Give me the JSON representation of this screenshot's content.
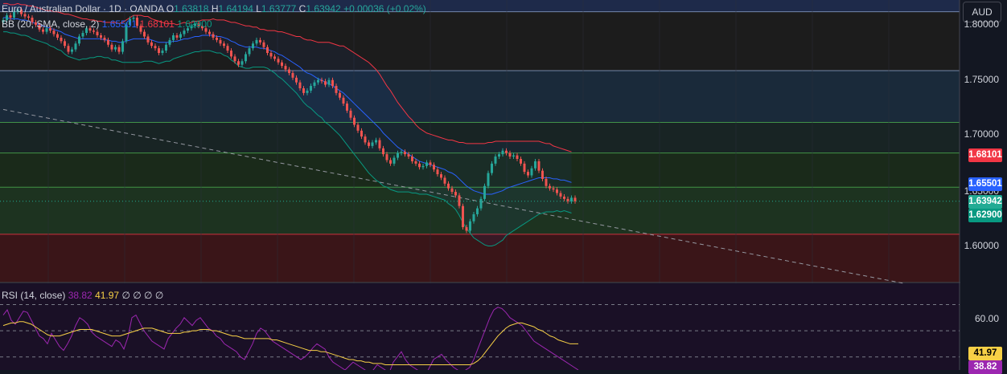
{
  "header": {
    "symbol": "Euro / Australian Dollar · 1D · OANDA",
    "open_label": "O",
    "open": "1.63818",
    "high_label": "H",
    "high": "1.64194",
    "low_label": "L",
    "low": "1.63777",
    "close_label": "C",
    "close": "1.63942",
    "change": "+0.00036 (+0.02%)"
  },
  "bb_legend": {
    "label": "BB (20, SMA, close, 2)",
    "basis": "1.65501",
    "upper": "1.68101",
    "lower": "1.62900"
  },
  "rsi_legend": {
    "label": "RSI (14, close)",
    "rsi": "38.82",
    "ma": "41.97",
    "extras": "∅ ∅ ∅ ∅"
  },
  "currency_button": "AUD",
  "price_axis": {
    "ticks": [
      "1.80000",
      "1.75000",
      "1.70000",
      "1.65000",
      "1.60000"
    ],
    "tags": {
      "upper": "1.68101",
      "basis": "1.65501",
      "close": "1.63942",
      "lower": "1.62900"
    }
  },
  "rsi_axis": {
    "ticks": [
      "60.00"
    ],
    "tags": {
      "ma": "41.97",
      "rsi": "38.82"
    }
  },
  "colors": {
    "up": "#26a69a",
    "down": "#ef5350",
    "basis": "#2962ff",
    "upper": "#f23645",
    "lower": "#089981",
    "rsi": "#9c27b0",
    "rsi_ma": "#f7d046",
    "close_tag": "#22ab94"
  },
  "chart_data": {
    "type": "candlestick",
    "instrument": "Euro / Australian Dollar",
    "interval": "1D",
    "source": "OANDA",
    "ylim": [
      1.57,
      1.81
    ],
    "zones": [
      {
        "from": 1.8,
        "to": 1.81,
        "color": "#1e2a4a"
      },
      {
        "from": 1.75,
        "to": 1.8,
        "color": "#1c1c1c"
      },
      {
        "from": 1.706,
        "to": 1.75,
        "color": "#1a2a3a"
      },
      {
        "from": 1.68,
        "to": 1.706,
        "color": "#182424"
      },
      {
        "from": 1.651,
        "to": 1.68,
        "color": "#1a2a1a"
      },
      {
        "from": 1.611,
        "to": 1.651,
        "color": "#1d3320"
      },
      {
        "from": 1.57,
        "to": 1.611,
        "color": "#3a1518"
      }
    ],
    "close_series": [
      1.793,
      1.797,
      1.795,
      1.8,
      1.802,
      1.798,
      1.796,
      1.795,
      1.791,
      1.789,
      1.785,
      1.783,
      1.786,
      1.784,
      1.781,
      1.778,
      1.775,
      1.771,
      1.766,
      1.768,
      1.773,
      1.779,
      1.782,
      1.786,
      1.784,
      1.783,
      1.78,
      1.778,
      1.776,
      1.772,
      1.768,
      1.77,
      1.766,
      1.775,
      1.789,
      1.794,
      1.795,
      1.788,
      1.783,
      1.779,
      1.774,
      1.771,
      1.769,
      1.765,
      1.767,
      1.772,
      1.776,
      1.78,
      1.778,
      1.781,
      1.784,
      1.786,
      1.788,
      1.79,
      1.788,
      1.786,
      1.783,
      1.781,
      1.778,
      1.776,
      1.773,
      1.771,
      1.767,
      1.762,
      1.758,
      1.755,
      1.758,
      1.764,
      1.769,
      1.773,
      1.776,
      1.774,
      1.77,
      1.765,
      1.762,
      1.76,
      1.757,
      1.754,
      1.751,
      1.748,
      1.744,
      1.74,
      1.735,
      1.731,
      1.733,
      1.737,
      1.74,
      1.742,
      1.741,
      1.738,
      1.742,
      1.737,
      1.731,
      1.727,
      1.722,
      1.716,
      1.71,
      1.704,
      1.699,
      1.694,
      1.689,
      1.686,
      1.689,
      1.691,
      1.684,
      1.679,
      1.674,
      1.671,
      1.676,
      1.68,
      1.681,
      1.679,
      1.677,
      1.673,
      1.671,
      1.668,
      1.669,
      1.672,
      1.67,
      1.666,
      1.662,
      1.659,
      1.654,
      1.65,
      1.647,
      1.644,
      1.635,
      1.617,
      1.614,
      1.622,
      1.628,
      1.633,
      1.641,
      1.652,
      1.663,
      1.671,
      1.677,
      1.679,
      1.682,
      1.68,
      1.677,
      1.678,
      1.675,
      1.671,
      1.664,
      1.661,
      1.667,
      1.673,
      1.665,
      1.658,
      1.652,
      1.65,
      1.649,
      1.646,
      1.643,
      1.641,
      1.639,
      1.642,
      1.639
    ],
    "bb_basis": [
      1.795,
      1.795,
      1.794,
      1.794,
      1.794,
      1.793,
      1.793,
      1.792,
      1.791,
      1.79,
      1.789,
      1.788,
      1.787,
      1.786,
      1.785,
      1.784,
      1.783,
      1.781,
      1.78,
      1.779,
      1.778,
      1.777,
      1.777,
      1.777,
      1.777,
      1.777,
      1.777,
      1.777,
      1.776,
      1.776,
      1.775,
      1.775,
      1.774,
      1.774,
      1.775,
      1.776,
      1.777,
      1.777,
      1.777,
      1.777,
      1.777,
      1.776,
      1.775,
      1.774,
      1.774,
      1.774,
      1.774,
      1.775,
      1.775,
      1.776,
      1.777,
      1.777,
      1.778,
      1.779,
      1.779,
      1.78,
      1.78,
      1.78,
      1.78,
      1.779,
      1.779,
      1.778,
      1.777,
      1.775,
      1.774,
      1.772,
      1.771,
      1.77,
      1.77,
      1.77,
      1.77,
      1.769,
      1.769,
      1.768,
      1.767,
      1.766,
      1.764,
      1.763,
      1.761,
      1.759,
      1.757,
      1.755,
      1.753,
      1.75,
      1.748,
      1.747,
      1.745,
      1.743,
      1.742,
      1.74,
      1.739,
      1.737,
      1.735,
      1.733,
      1.731,
      1.728,
      1.725,
      1.722,
      1.719,
      1.716,
      1.713,
      1.71,
      1.707,
      1.704,
      1.701,
      1.697,
      1.694,
      1.691,
      1.688,
      1.685,
      1.683,
      1.681,
      1.679,
      1.677,
      1.675,
      1.673,
      1.672,
      1.671,
      1.67,
      1.669,
      1.668,
      1.667,
      1.666,
      1.664,
      1.663,
      1.661,
      1.658,
      1.655,
      1.652,
      1.65,
      1.648,
      1.647,
      1.646,
      1.645,
      1.645,
      1.645,
      1.646,
      1.647,
      1.648,
      1.65,
      1.651,
      1.652,
      1.653,
      1.654,
      1.655,
      1.656,
      1.657,
      1.658,
      1.659,
      1.659,
      1.659,
      1.659,
      1.658,
      1.658,
      1.657,
      1.657,
      1.656,
      1.655
    ],
    "bb_width": [
      0.012,
      0.012,
      0.012,
      0.012,
      0.013,
      0.013,
      0.013,
      0.013,
      0.014,
      0.014,
      0.014,
      0.014,
      0.014,
      0.015,
      0.015,
      0.016,
      0.016,
      0.017,
      0.018,
      0.018,
      0.018,
      0.018,
      0.017,
      0.017,
      0.016,
      0.016,
      0.015,
      0.015,
      0.015,
      0.015,
      0.016,
      0.016,
      0.016,
      0.017,
      0.018,
      0.019,
      0.02,
      0.02,
      0.02,
      0.019,
      0.019,
      0.018,
      0.018,
      0.018,
      0.017,
      0.016,
      0.016,
      0.015,
      0.014,
      0.014,
      0.014,
      0.013,
      0.013,
      0.013,
      0.013,
      0.013,
      0.013,
      0.013,
      0.014,
      0.014,
      0.014,
      0.015,
      0.015,
      0.016,
      0.017,
      0.018,
      0.018,
      0.018,
      0.018,
      0.017,
      0.017,
      0.016,
      0.016,
      0.016,
      0.017,
      0.018,
      0.019,
      0.02,
      0.021,
      0.022,
      0.023,
      0.024,
      0.026,
      0.027,
      0.028,
      0.029,
      0.03,
      0.031,
      0.032,
      0.034,
      0.035,
      0.036,
      0.037,
      0.038,
      0.04,
      0.041,
      0.042,
      0.043,
      0.044,
      0.045,
      0.046,
      0.047,
      0.047,
      0.047,
      0.046,
      0.045,
      0.043,
      0.042,
      0.04,
      0.038,
      0.036,
      0.034,
      0.032,
      0.031,
      0.029,
      0.028,
      0.027,
      0.026,
      0.026,
      0.026,
      0.026,
      0.026,
      0.026,
      0.027,
      0.028,
      0.029,
      0.031,
      0.034,
      0.036,
      0.038,
      0.04,
      0.041,
      0.042,
      0.043,
      0.044,
      0.044,
      0.044,
      0.043,
      0.042,
      0.04,
      0.039,
      0.038,
      0.037,
      0.036,
      0.035,
      0.034,
      0.033,
      0.032,
      0.031,
      0.03,
      0.029,
      0.029,
      0.028,
      0.027,
      0.027,
      0.026,
      0.026,
      0.026,
      0.026,
      0.026
    ],
    "trend_line": {
      "from_index": 0,
      "from_price": 1.717,
      "to_index": 160,
      "to_price": 1.622,
      "style": "dashed"
    },
    "rsi": [
      62,
      66,
      58,
      55,
      60,
      65,
      64,
      58,
      52,
      46,
      44,
      40,
      48,
      43,
      38,
      35,
      40,
      46,
      54,
      60,
      58,
      55,
      49,
      46,
      44,
      42,
      40,
      38,
      43,
      41,
      36,
      45,
      60,
      62,
      56,
      50,
      46,
      42,
      40,
      38,
      36,
      44,
      48,
      52,
      55,
      60,
      57,
      54,
      58,
      60,
      56,
      52,
      50,
      46,
      44,
      40,
      38,
      36,
      34,
      30,
      28,
      34,
      40,
      48,
      52,
      50,
      46,
      42,
      40,
      38,
      36,
      34,
      32,
      30,
      28,
      30,
      33,
      37,
      40,
      38,
      36,
      30,
      26,
      24,
      22,
      20,
      23,
      26,
      24,
      22,
      20,
      18,
      20,
      24,
      22,
      20,
      18,
      26,
      30,
      34,
      28,
      24,
      22,
      20,
      18,
      16,
      22,
      28,
      30,
      32,
      28,
      25,
      22,
      20,
      18,
      20,
      22,
      28,
      36,
      44,
      52,
      60,
      66,
      68,
      67,
      64,
      60,
      58,
      56,
      54,
      50,
      46,
      42,
      40,
      38,
      36,
      34,
      32,
      30,
      28,
      26,
      24,
      22,
      20
    ],
    "rsi_ma": [
      54,
      55,
      56,
      56,
      57,
      57,
      56,
      55,
      53,
      51,
      49,
      47,
      46,
      46,
      46,
      47,
      48,
      49,
      50,
      51,
      51,
      51,
      51,
      50,
      49,
      48,
      47,
      46,
      46,
      46,
      47,
      48,
      49,
      50,
      51,
      52,
      52,
      52,
      51,
      50,
      49,
      48,
      48,
      48,
      48,
      49,
      49,
      50,
      50,
      51,
      51,
      51,
      50,
      50,
      49,
      48,
      47,
      46,
      46,
      45,
      44,
      44,
      44,
      44,
      44,
      44,
      44,
      43,
      43,
      42,
      41,
      40,
      39,
      38,
      37,
      36,
      35,
      35,
      35,
      34,
      34,
      33,
      32,
      31,
      30,
      29,
      28,
      28,
      27,
      27,
      26,
      26,
      25,
      25,
      25,
      24,
      24,
      24,
      24,
      24,
      24,
      24,
      24,
      24,
      24,
      24,
      24,
      24,
      24,
      24,
      24,
      24,
      24,
      24,
      24,
      24,
      24,
      25,
      27,
      30,
      34,
      38,
      42,
      46,
      49,
      52,
      54,
      55,
      56,
      56,
      55,
      54,
      53,
      51,
      50,
      48,
      46,
      45,
      43,
      42,
      41,
      40,
      40,
      40
    ],
    "rsi_levels": [
      70,
      50,
      30
    ],
    "rsi_ylim": [
      20,
      82
    ]
  }
}
